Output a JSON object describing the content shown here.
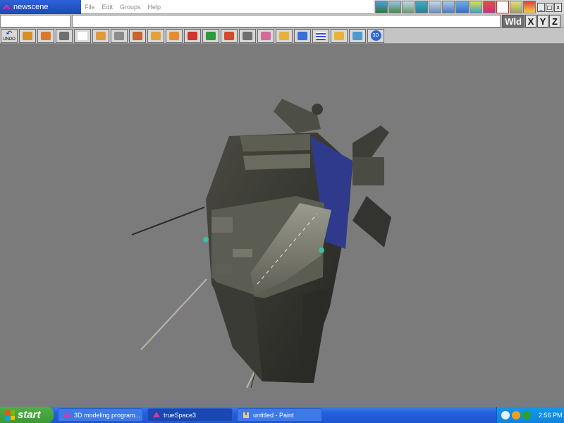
{
  "window": {
    "title": "newscene",
    "menus": [
      "File",
      "Edit",
      "Groups",
      "Help"
    ],
    "top_icons": [
      "render-icon",
      "path-icon",
      "plane-icon",
      "light-icon",
      "display-icon",
      "camera-icon",
      "grid-icon",
      "material-icon",
      "paint-icon",
      "library-icon",
      "frame-icon",
      "grid2-icon",
      "help-icon"
    ],
    "controls": [
      "_",
      "□",
      "x"
    ]
  },
  "axis": {
    "mode": "Wld",
    "x": "X",
    "y": "Y",
    "z": "Z"
  },
  "toolbar": {
    "undo_label": "UNDO",
    "tools": [
      {
        "name": "object-tool-icon",
        "color": "#d58f2a"
      },
      {
        "name": "cube-icon",
        "color": "#d97a2a"
      },
      {
        "name": "camera-tool-icon",
        "color": "#6f6f6f"
      },
      {
        "name": "pointer-icon",
        "color": "#ffffff"
      },
      {
        "name": "rotate-icon",
        "color": "#e09a3a"
      },
      {
        "name": "navigate-icon",
        "color": "#8c8c8c"
      },
      {
        "name": "scale-icon",
        "color": "#c8632c"
      },
      {
        "name": "shape-icon",
        "color": "#e1a23a"
      },
      {
        "name": "sphere-icon",
        "color": "#e58d2e"
      },
      {
        "name": "material-ball-icon",
        "color": "#d0342c"
      },
      {
        "name": "deform-icon",
        "color": "#2e9a3c"
      },
      {
        "name": "link-icon",
        "color": "#d44a2c"
      },
      {
        "name": "spline-icon",
        "color": "#6f6f6f"
      },
      {
        "name": "paint-brush-icon",
        "color": "#d36a9a"
      },
      {
        "name": "edit-icon",
        "color": "#e6b13a"
      },
      {
        "name": "primitives-icon",
        "color": "#3a6fd8"
      },
      {
        "name": "grid-tool-icon",
        "color": "#3a4fd0"
      },
      {
        "name": "light-tool-icon",
        "color": "#e8b23a"
      },
      {
        "name": "group-icon",
        "color": "#4d9ad0"
      },
      {
        "name": "view-3d-icon",
        "color": "#2f66d6"
      }
    ],
    "tool_label_3d": "3D"
  },
  "scene": {
    "object": "space-carrier-model",
    "background": "#7b7b7b"
  },
  "taskbar": {
    "start_label": "start",
    "tasks": [
      {
        "label": "3D modeling program...",
        "active": false
      },
      {
        "label": "trueSpace3",
        "active": true
      },
      {
        "label": "untitled - Paint",
        "active": false
      }
    ],
    "clock": "2:56 PM"
  }
}
